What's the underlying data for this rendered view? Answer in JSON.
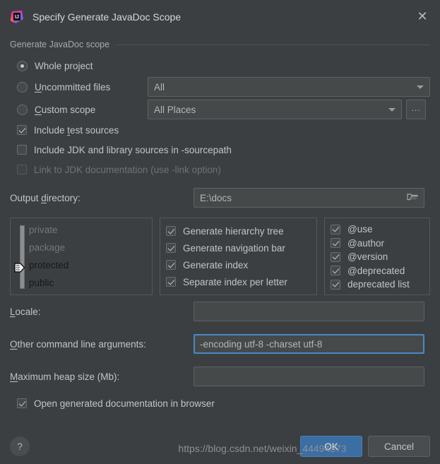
{
  "window": {
    "title": "Specify Generate JavaDoc Scope",
    "logo_icon": "intellij-idea-logo",
    "close_icon": "close-icon",
    "accent_color": "#3b6ea3",
    "focus_border_color": "#4a88c7",
    "background_color": "#3c3f41"
  },
  "scope_group": {
    "title": "Generate JavaDoc scope",
    "options": [
      {
        "label": "Whole project",
        "mnemonic": "j",
        "selected": true
      },
      {
        "label": "Uncommitted files",
        "mnemonic": "U",
        "selected": false
      },
      {
        "label": "Custom scope",
        "mnemonic": "C",
        "selected": false
      }
    ],
    "uncommitted_combo": {
      "value": "All",
      "icon": "chevron-down-icon"
    },
    "custom_scope_combo": {
      "value": "All Places",
      "icon": "chevron-down-icon"
    },
    "browse_button_label": "..."
  },
  "source_options": [
    {
      "label": "Include test sources",
      "mnemonic": "t",
      "checked": true,
      "enabled": true
    },
    {
      "label": "Include JDK and library sources in -sourcepath",
      "checked": false,
      "enabled": true
    },
    {
      "label": "Link to JDK documentation (use -link option)",
      "checked": false,
      "enabled": false
    }
  ],
  "output_directory": {
    "label": "Output directory:",
    "mnemonic": "d",
    "value": "E:\\docs",
    "browse_icon": "folder-icon"
  },
  "visibility_panel": {
    "levels": [
      "private",
      "package",
      "protected",
      "public"
    ],
    "selected": "protected",
    "slider_icon": "slider-thumb-icon"
  },
  "generate_options": [
    {
      "label": "Generate hierarchy tree",
      "checked": true
    },
    {
      "label": "Generate navigation bar",
      "checked": true
    },
    {
      "label": "Generate index",
      "checked": true
    },
    {
      "label": "Separate index per letter",
      "checked": true
    }
  ],
  "tag_options": [
    {
      "label": "@use",
      "checked": true
    },
    {
      "label": "@author",
      "checked": true
    },
    {
      "label": "@version",
      "checked": true
    },
    {
      "label": "@deprecated",
      "checked": true
    },
    {
      "label": "deprecated list",
      "checked": true
    }
  ],
  "locale": {
    "label": "Locale:",
    "mnemonic": "L",
    "value": "",
    "placeholder": ""
  },
  "other_args": {
    "label": "Other command line arguments:",
    "mnemonic": "O",
    "value": "-encoding utf-8 -charset utf-8",
    "focused": true
  },
  "heap_size": {
    "label": "Maximum heap size (Mb):",
    "mnemonic": "M",
    "value": "",
    "placeholder": ""
  },
  "open_in_browser": {
    "label": "Open generated documentation in browser",
    "mnemonic": "g",
    "checked": true
  },
  "footer": {
    "help_label": "?",
    "help_icon": "question-mark-icon",
    "ok_label": "OK",
    "cancel_label": "Cancel"
  },
  "watermark": {
    "text": "https://blog.csdn.net/weixin_44494373"
  }
}
